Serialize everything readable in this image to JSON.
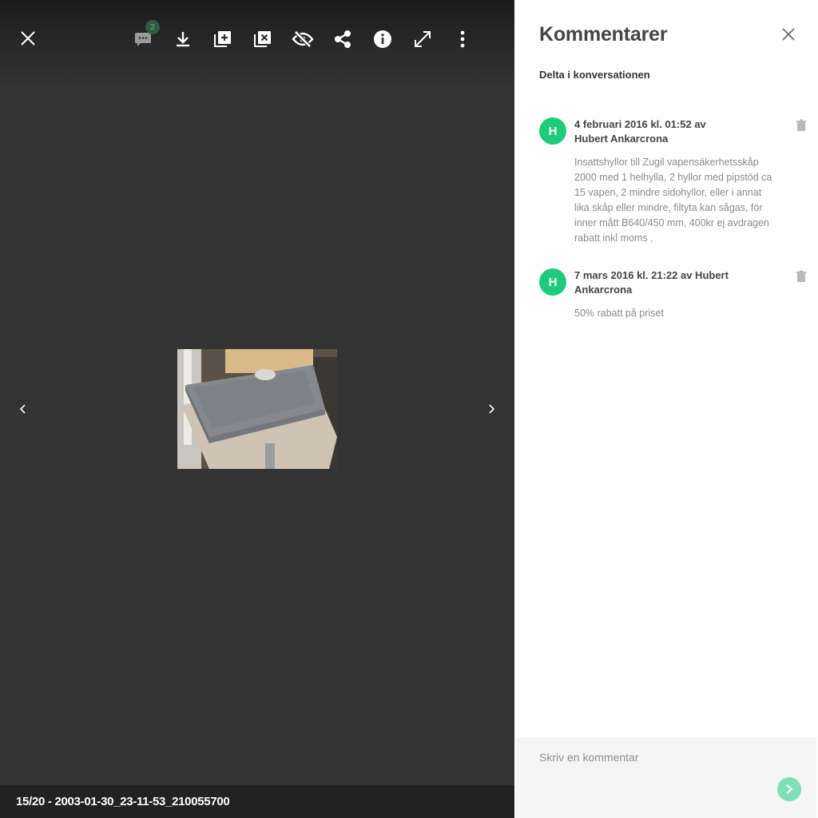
{
  "viewer": {
    "caption": "15/20 - 2003-01-30_23-11-53_210055700",
    "comment_badge_count": "2",
    "toolbar_icons": [
      "comment-icon",
      "download-icon",
      "add-to-album-icon",
      "remove-from-album-icon",
      "hide-icon",
      "share-icon",
      "info-icon",
      "fullscreen-icon",
      "more-icon"
    ]
  },
  "panel": {
    "title": "Kommentarer",
    "subtitle": "Delta i konversationen",
    "comments": [
      {
        "avatar": "H",
        "meta": "4 februari 2016 kl. 01:52 av Hubert Ankarcrona",
        "text": "Insattshyllor till Zugil vapensäkerhetsskåp 2000 med 1 helhylla, 2 hyllor med pipstöd ca 15 vapen, 2 mindre sidohyllor, eller i annat lika skåp eller mindre, filtyta kan sågas, för inner mått B640/450 mm, 400kr ej avdragen rabatt inkl moms ,"
      },
      {
        "avatar": "H",
        "meta": "7 mars 2016 kl. 21:22 av Hubert Ankarcrona",
        "text": "50% rabatt på priset"
      }
    ],
    "composer_placeholder": "Skriv en kommentar"
  },
  "colors": {
    "viewer_bg": "#333333",
    "avatar": "#1dcc7a",
    "send_button": "#7ee0b6"
  }
}
